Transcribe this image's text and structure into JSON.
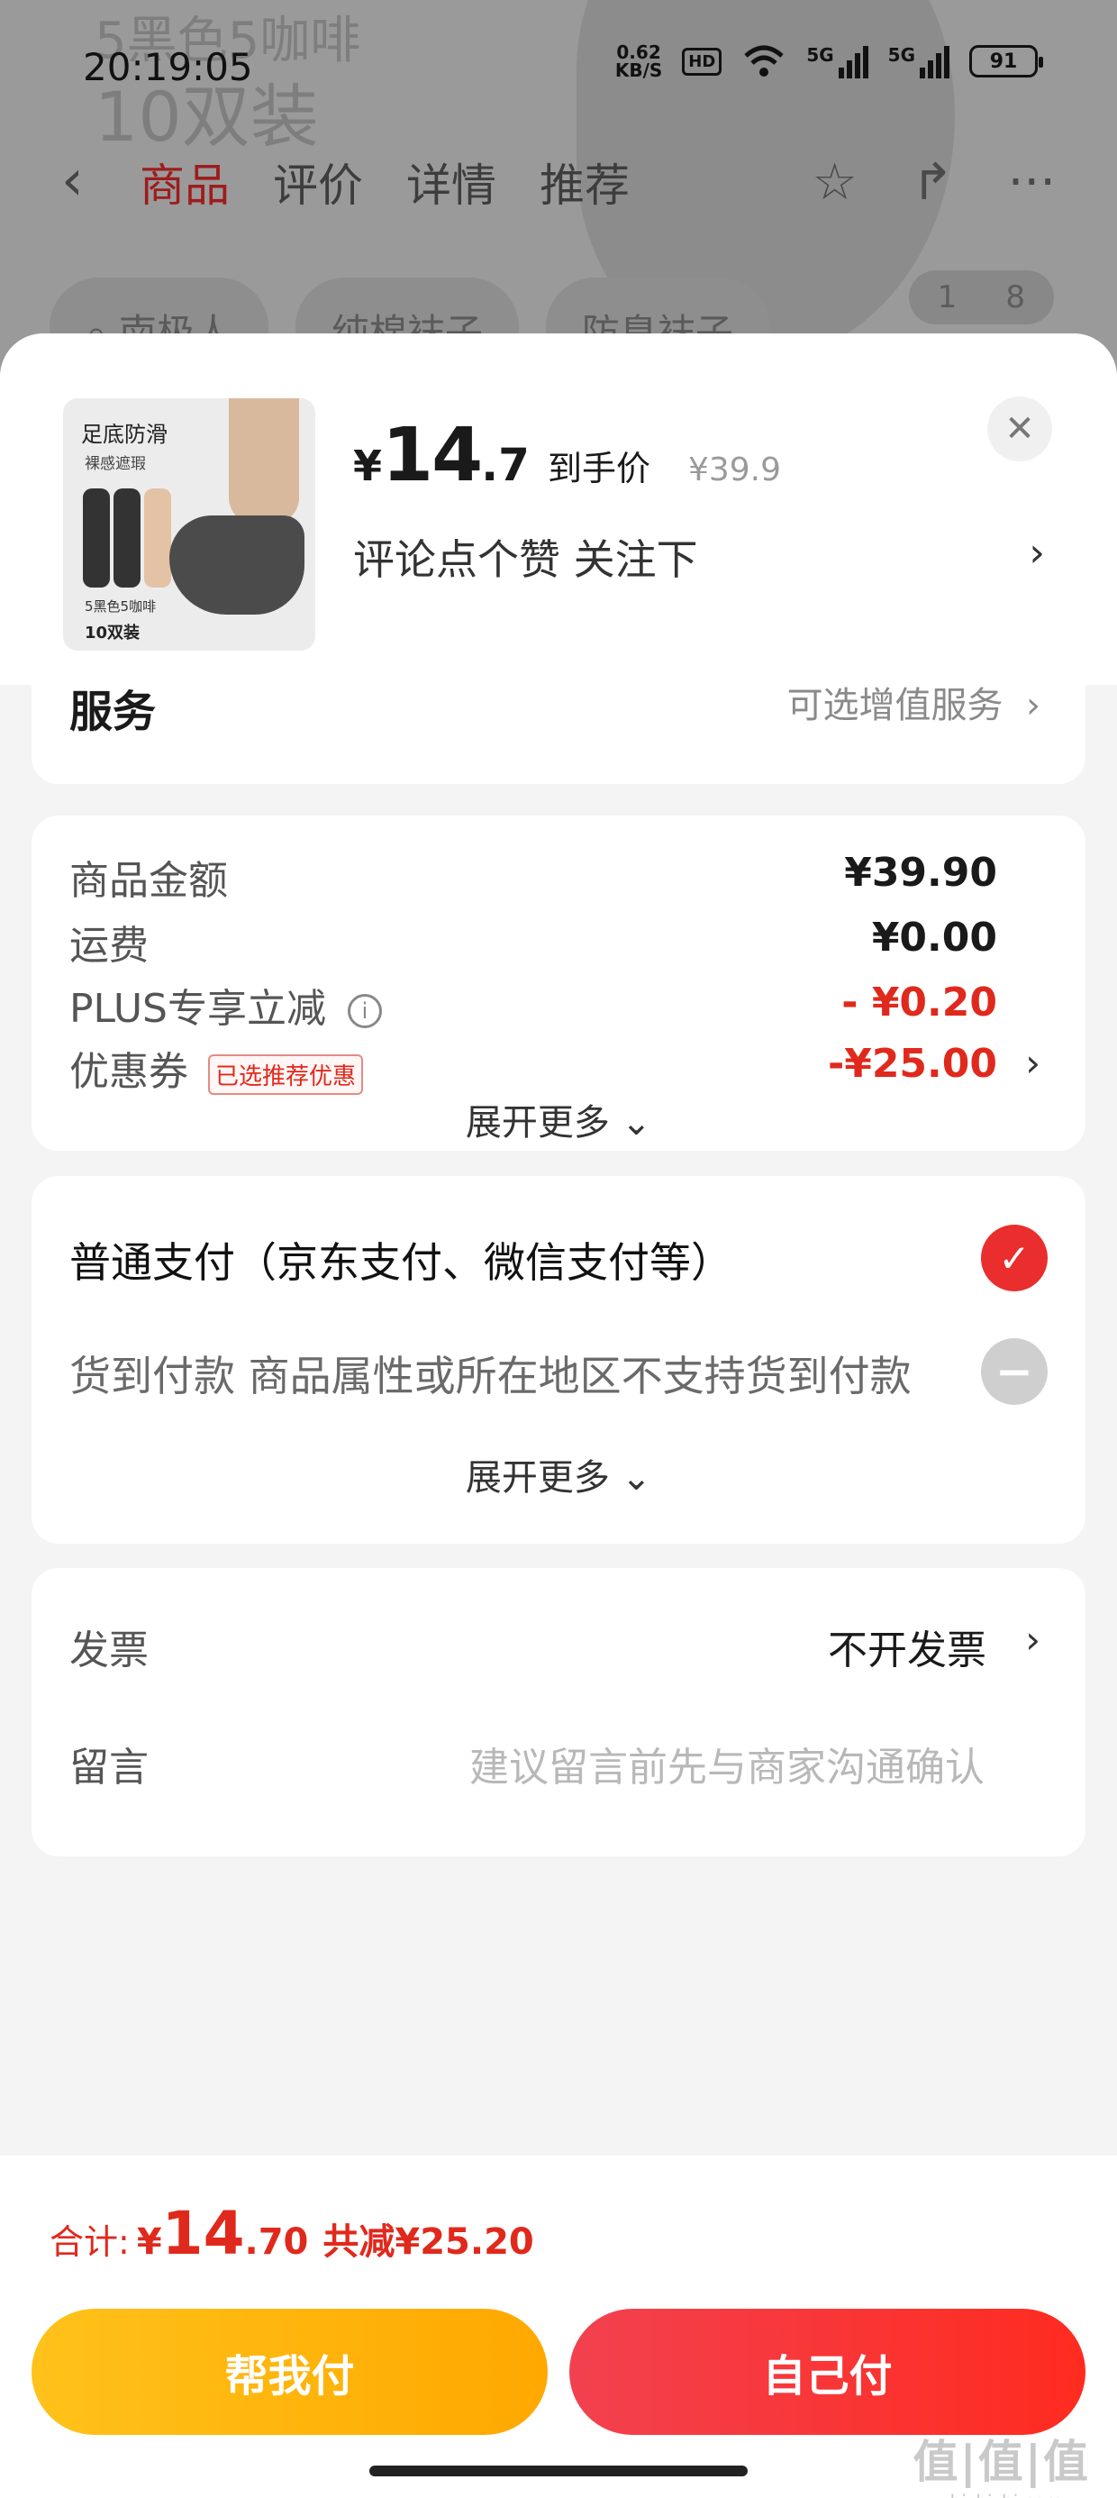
{
  "status_bar": {
    "time": "20:19:05",
    "net_speed_value": "0.62",
    "net_speed_unit": "KB/S",
    "hd_badge": "HD",
    "signal_1": "5G",
    "signal_2": "5G",
    "battery": "91"
  },
  "background_page": {
    "faded_text_1": "5黑色5咖啡",
    "faded_text_2": "10双装",
    "tabs": [
      "商品",
      "评价",
      "详情",
      "推荐"
    ],
    "search_chip_1": "南极人",
    "search_chip_2": "纯棉袜子",
    "search_chip_3": "防臭袜子",
    "page_indicator_current": "1",
    "page_indicator_total": "8"
  },
  "product": {
    "thumb_title": "足底防滑",
    "thumb_sub": "裸感遮瑕",
    "thumb_caption": "5黑色5咖啡",
    "thumb_caption2": "10双装",
    "price_yen": "¥",
    "price_int": "14",
    "price_dec": ".7",
    "price_label": "到手价",
    "original_price": "¥39.9",
    "promo": "评论点个赞  关注下"
  },
  "service": {
    "title": "服务",
    "hint": "可选增值服务"
  },
  "costs": {
    "rows": [
      {
        "label": "商品金额",
        "value": "¥39.90"
      },
      {
        "label": "运费",
        "value": "¥0.00"
      },
      {
        "label": "PLUS专享立减",
        "value": "- ¥0.20"
      },
      {
        "label": "优惠券",
        "value": "-¥25.00"
      }
    ],
    "coupon_tag": "已选推荐优惠",
    "expand_label": "展开更多"
  },
  "payment": {
    "option_1": "普通支付（京东支付、微信支付等）",
    "option_2": "货到付款 商品属性或所在地区不支持货到付款",
    "expand_label": "展开更多"
  },
  "extra": {
    "invoice_label": "发票",
    "invoice_value": "不开发票",
    "note_label": "留言",
    "note_placeholder": "建议留言前先与商家沟通确认"
  },
  "footer": {
    "total_label": "合计:",
    "total_yen": "¥",
    "total_int": "14",
    "total_dec": ".70",
    "total_saved": "共减¥25.20",
    "help_pay": "帮我付",
    "self_pay": "自己付",
    "watermark_1": "值|值|值",
    "watermark_2": "zhizhizhi.com"
  },
  "colors": {
    "accent_red": "#e0291d",
    "help_button": "#ffb30f",
    "self_button": "#f8362f"
  }
}
